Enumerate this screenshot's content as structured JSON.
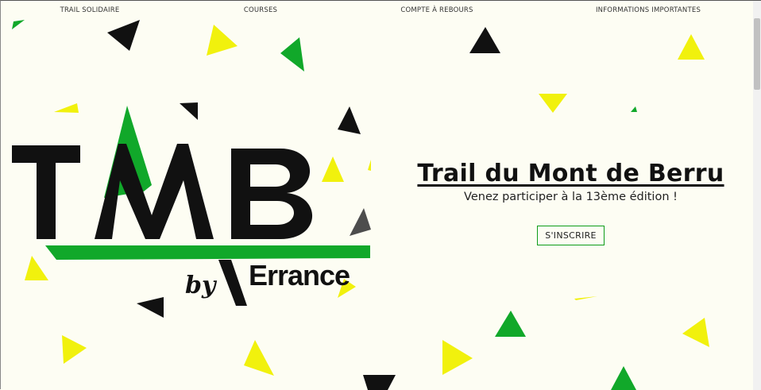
{
  "nav": {
    "items": [
      {
        "label": "TRAIL SOLIDAIRE"
      },
      {
        "label": "COURSES"
      },
      {
        "label": "COMPTE À REBOURS"
      },
      {
        "label": "INFORMATIONS IMPORTANTES"
      }
    ]
  },
  "logo": {
    "letters": "TMB",
    "by": "by",
    "brand": "Errance"
  },
  "hero": {
    "title": "Trail du Mont de Berru",
    "subtitle": "Venez participer à la 13ème édition !",
    "cta_label": "S'INSCRIRE"
  },
  "colors": {
    "background": "#fdfdf3",
    "green": "#11a82a",
    "yellow": "#f1f10d",
    "black": "#111111",
    "gray": "#4d4d4d"
  }
}
